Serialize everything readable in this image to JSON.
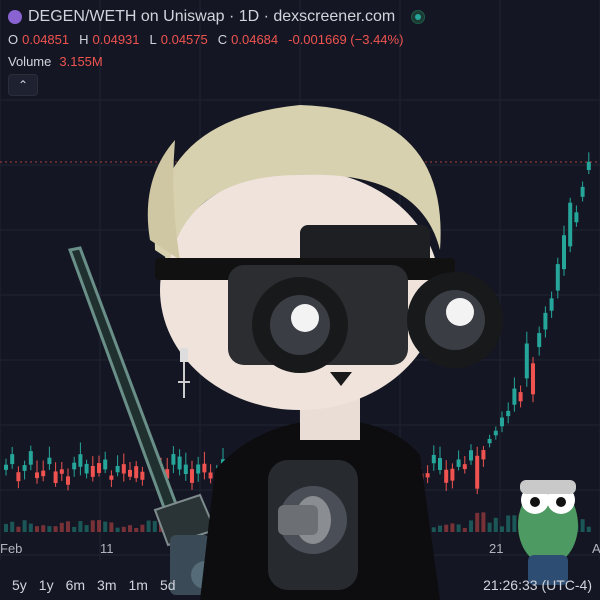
{
  "header": {
    "title": "DEGEN/WETH on Uniswap · 1D · dexscreener.com",
    "ohlc": [
      {
        "key": "O",
        "value": "0.04851"
      },
      {
        "key": "H",
        "value": "0.04931"
      },
      {
        "key": "L",
        "value": "0.04575"
      },
      {
        "key": "C",
        "value": "0.04684"
      }
    ],
    "change": "-0.001669 (−3.44%)",
    "volume_label": "Volume",
    "volume_value": "3.155M",
    "collapse_glyph": "⌃"
  },
  "xaxis": {
    "labels": [
      "Feb",
      "11",
      "21",
      "A"
    ]
  },
  "range_buttons": [
    "5y",
    "1y",
    "6m",
    "3m",
    "1m",
    "5d"
  ],
  "clock": "21:26:33 (UTC-4)",
  "colors": {
    "background": "#141723",
    "up": "#26a69a",
    "down": "#ef5350",
    "logo": "#8a63d2"
  },
  "icons": {
    "logo": "degen-token-logo-icon",
    "live": "live-status-icon",
    "collapse": "chevron-up-icon"
  },
  "chart_data": {
    "type": "candlestick",
    "interval": "1D",
    "x": [
      "Feb",
      "11",
      "21",
      "A"
    ],
    "up_color": "#26a69a",
    "down_color": "#ef5350",
    "grid": true
  }
}
